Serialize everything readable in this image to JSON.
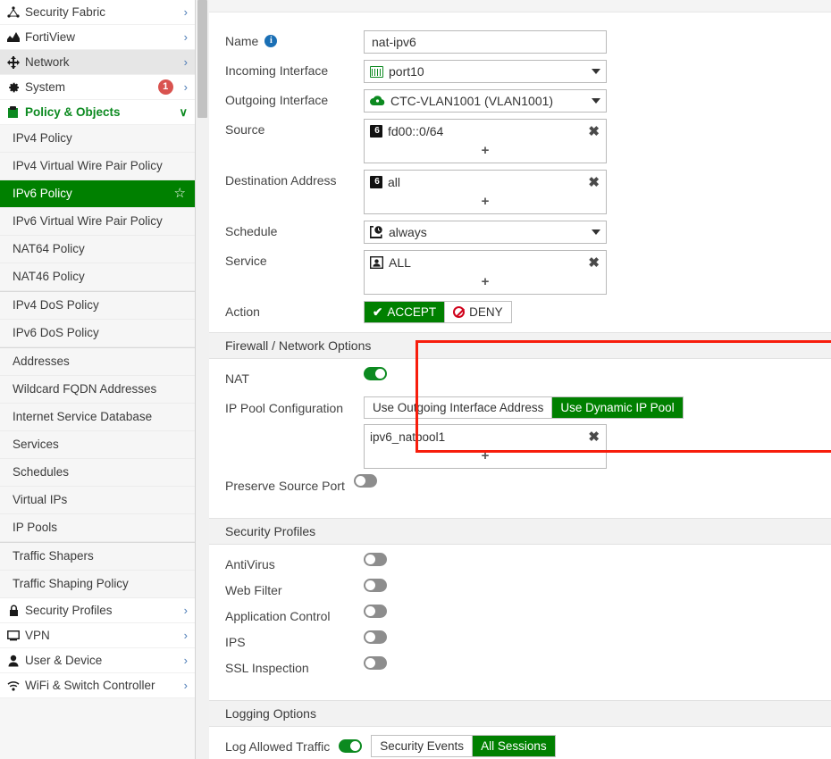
{
  "sidebar": {
    "top_items": [
      {
        "label": "Security Fabric",
        "icon": "security-fabric-icon",
        "chevron": "›",
        "badge": null,
        "state": "normal"
      },
      {
        "label": "FortiView",
        "icon": "fortiview-icon",
        "chevron": "›",
        "badge": null,
        "state": "normal"
      },
      {
        "label": "Network",
        "icon": "network-icon",
        "chevron": "›",
        "badge": null,
        "state": "hover"
      },
      {
        "label": "System",
        "icon": "system-gear-icon",
        "chevron": "›",
        "badge": "1",
        "state": "normal"
      },
      {
        "label": "Policy & Objects",
        "icon": "policy-objects-icon",
        "chevron": "∨",
        "badge": null,
        "state": "expanded"
      }
    ],
    "policy_items": [
      {
        "label": "IPv4 Policy",
        "active": false
      },
      {
        "label": "IPv4 Virtual Wire Pair Policy",
        "active": false
      },
      {
        "label": "IPv6 Policy",
        "active": true,
        "star": "☆"
      },
      {
        "label": "IPv6 Virtual Wire Pair Policy",
        "active": false
      },
      {
        "label": "NAT64 Policy",
        "active": false
      },
      {
        "label": "NAT46 Policy",
        "active": false
      }
    ],
    "dos_items": [
      {
        "label": "IPv4 DoS Policy"
      },
      {
        "label": "IPv6 DoS Policy"
      }
    ],
    "object_items": [
      {
        "label": "Addresses"
      },
      {
        "label": "Wildcard FQDN Addresses"
      },
      {
        "label": "Internet Service Database"
      },
      {
        "label": "Services"
      },
      {
        "label": "Schedules"
      },
      {
        "label": "Virtual IPs"
      },
      {
        "label": "IP Pools"
      }
    ],
    "shaper_items": [
      {
        "label": "Traffic Shapers"
      },
      {
        "label": "Traffic Shaping Policy"
      }
    ],
    "bottom_items": [
      {
        "label": "Security Profiles",
        "icon": "lock-icon",
        "chevron": "›"
      },
      {
        "label": "VPN",
        "icon": "vpn-icon",
        "chevron": "›"
      },
      {
        "label": "User & Device",
        "icon": "user-icon",
        "chevron": "›"
      },
      {
        "label": "WiFi & Switch Controller",
        "icon": "wifi-icon",
        "chevron": "›"
      }
    ]
  },
  "form": {
    "name": {
      "label": "Name",
      "value": "nat-ipv6",
      "info": "i"
    },
    "incoming_interface": {
      "label": "Incoming Interface",
      "value": "port10",
      "icon": "ethernet-port-icon"
    },
    "outgoing_interface": {
      "label": "Outgoing Interface",
      "value": "CTC-VLAN1001 (VLAN1001)",
      "icon": "cloud-interface-icon"
    },
    "source": {
      "label": "Source",
      "items": [
        {
          "value": "fd00::0/64",
          "icon": "ipv6-address-icon"
        }
      ],
      "add": "+",
      "remove": "✖"
    },
    "destination": {
      "label": "Destination Address",
      "items": [
        {
          "value": "all",
          "icon": "ipv6-address-icon"
        }
      ],
      "add": "+",
      "remove": "✖"
    },
    "schedule": {
      "label": "Schedule",
      "value": "always",
      "icon": "schedule-clock-icon"
    },
    "service": {
      "label": "Service",
      "items": [
        {
          "value": "ALL",
          "icon": "service-icon"
        }
      ],
      "add": "+",
      "remove": "✖"
    },
    "action": {
      "label": "Action",
      "options": [
        {
          "label": "ACCEPT",
          "selected": true,
          "icon": "check-icon"
        },
        {
          "label": "DENY",
          "selected": false,
          "icon": "deny-icon"
        }
      ]
    }
  },
  "firewall_section": {
    "title": "Firewall / Network Options",
    "nat": {
      "label": "NAT",
      "enabled": true
    },
    "ip_pool_configuration": {
      "label": "IP Pool Configuration",
      "options": [
        {
          "label": "Use Outgoing Interface Address",
          "selected": false
        },
        {
          "label": "Use Dynamic IP Pool",
          "selected": true
        }
      ],
      "pools": [
        {
          "value": "ipv6_natpool1"
        }
      ],
      "add": "+",
      "remove": "✖"
    },
    "preserve_source_port": {
      "label": "Preserve Source Port",
      "enabled": false
    }
  },
  "security_profiles": {
    "title": "Security Profiles",
    "items": [
      {
        "label": "AntiVirus",
        "enabled": false
      },
      {
        "label": "Web Filter",
        "enabled": false
      },
      {
        "label": "Application Control",
        "enabled": false
      },
      {
        "label": "IPS",
        "enabled": false
      },
      {
        "label": "SSL Inspection",
        "enabled": false
      }
    ]
  },
  "logging_options": {
    "title": "Logging Options",
    "log_allowed_traffic": {
      "label": "Log Allowed Traffic",
      "enabled": true
    },
    "log_modes": [
      {
        "label": "Security Events",
        "selected": false
      },
      {
        "label": "All Sessions",
        "selected": true
      }
    ]
  },
  "colors": {
    "accent_green": "#008000",
    "toggle_green": "#0c8a20",
    "highlight_red": "#f71d0c",
    "badge_red": "#d9534f"
  }
}
